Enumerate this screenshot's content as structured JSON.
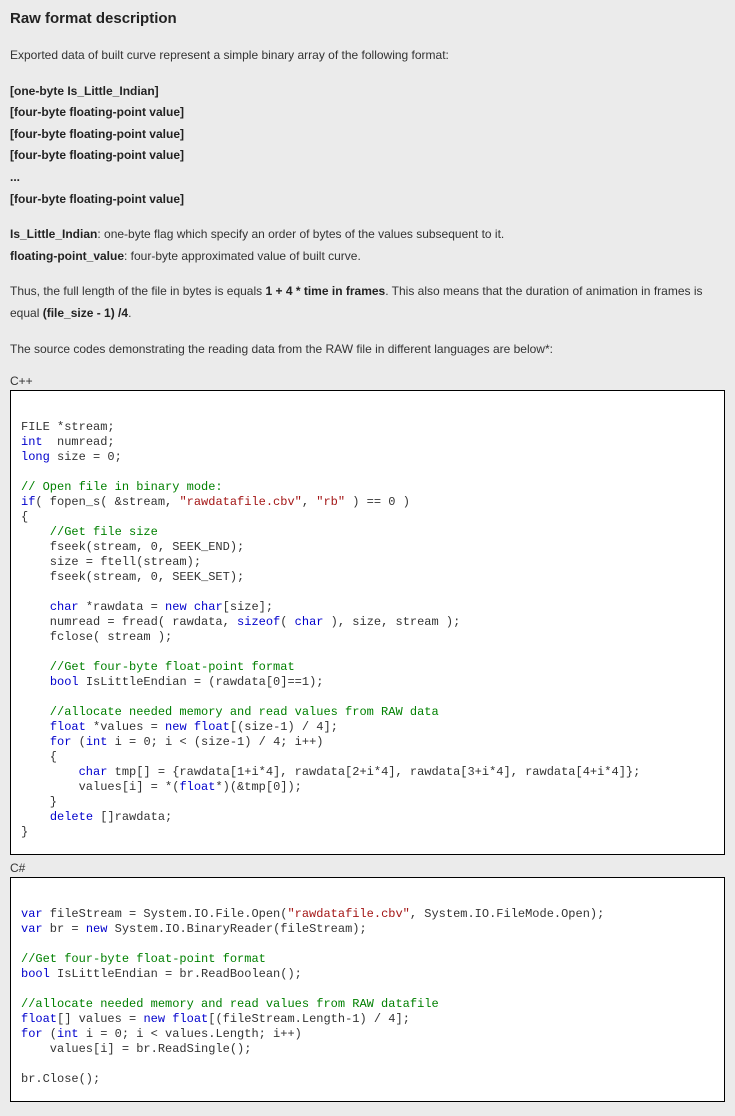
{
  "heading": "Raw format description",
  "intro": "Exported data of built curve represent a simple binary array of the following format:",
  "format_lines": [
    "[one-byte Is_Little_Indian]",
    "[four-byte floating-point value]",
    "[four-byte floating-point value]",
    "[four-byte floating-point value]",
    "...",
    "[four-byte floating-point value]"
  ],
  "definitions": [
    {
      "term": "Is_Little_Indian",
      "desc": ": one-byte flag which specify an order of bytes of the values subsequent to it."
    },
    {
      "term": "floating-point_value",
      "desc": ": four-byte approximated value of built curve."
    }
  ],
  "length_sentence": {
    "pre": "Thus, the full length of the file in bytes is equals ",
    "bold1": "1 + 4 * time in frames",
    "mid": ". This also means that the duration of animation in frames is equal ",
    "bold2": "(file_size - 1) /4",
    "post": "."
  },
  "source_intro": "The source codes demonstrating the reading data from the RAW file in different languages are below*:",
  "code_blocks": [
    {
      "label": "C++",
      "tokens": [
        {
          "t": "\n",
          "c": ""
        },
        {
          "t": "FILE",
          "c": ""
        },
        {
          "t": " *stream;\n",
          "c": ""
        },
        {
          "t": "int",
          "c": "kw"
        },
        {
          "t": "  numread;\n",
          "c": ""
        },
        {
          "t": "long",
          "c": "kw"
        },
        {
          "t": " size = 0;\n\n",
          "c": ""
        },
        {
          "t": "// Open file in binary mode:\n",
          "c": "cmt"
        },
        {
          "t": "if",
          "c": "kw"
        },
        {
          "t": "( fopen_s( &stream, ",
          "c": ""
        },
        {
          "t": "\"rawdatafile.cbv\"",
          "c": "str"
        },
        {
          "t": ", ",
          "c": ""
        },
        {
          "t": "\"rb\"",
          "c": "str"
        },
        {
          "t": " ) == 0 )\n{\n",
          "c": ""
        },
        {
          "t": "    //Get file size\n",
          "c": "cmt"
        },
        {
          "t": "    fseek(stream, 0, SEEK_END);\n",
          "c": ""
        },
        {
          "t": "    size = ftell(stream);\n",
          "c": ""
        },
        {
          "t": "    fseek(stream, 0, SEEK_SET);\n\n",
          "c": ""
        },
        {
          "t": "    ",
          "c": ""
        },
        {
          "t": "char",
          "c": "kw"
        },
        {
          "t": " *rawdata = ",
          "c": ""
        },
        {
          "t": "new",
          "c": "kw"
        },
        {
          "t": " ",
          "c": ""
        },
        {
          "t": "char",
          "c": "kw"
        },
        {
          "t": "[size];\n",
          "c": ""
        },
        {
          "t": "    numread = fread( rawdata, ",
          "c": ""
        },
        {
          "t": "sizeof",
          "c": "kw"
        },
        {
          "t": "( ",
          "c": ""
        },
        {
          "t": "char",
          "c": "kw"
        },
        {
          "t": " ), size, stream );\n",
          "c": ""
        },
        {
          "t": "    fclose( stream );\n\n",
          "c": ""
        },
        {
          "t": "    //Get four-byte float-point format\n",
          "c": "cmt"
        },
        {
          "t": "    ",
          "c": ""
        },
        {
          "t": "bool",
          "c": "kw"
        },
        {
          "t": " IsLittleEndian = (rawdata[0]==1);\n\n",
          "c": ""
        },
        {
          "t": "    //allocate needed memory and read values from RAW data\n",
          "c": "cmt"
        },
        {
          "t": "    ",
          "c": ""
        },
        {
          "t": "float",
          "c": "kw"
        },
        {
          "t": " *values = ",
          "c": ""
        },
        {
          "t": "new",
          "c": "kw"
        },
        {
          "t": " ",
          "c": ""
        },
        {
          "t": "float",
          "c": "kw"
        },
        {
          "t": "[(size-1) / 4];\n",
          "c": ""
        },
        {
          "t": "    ",
          "c": ""
        },
        {
          "t": "for",
          "c": "kw"
        },
        {
          "t": " (",
          "c": ""
        },
        {
          "t": "int",
          "c": "kw"
        },
        {
          "t": " i = 0; i < (size-1) / 4; i++)\n",
          "c": ""
        },
        {
          "t": "    {\n",
          "c": ""
        },
        {
          "t": "        ",
          "c": ""
        },
        {
          "t": "char",
          "c": "kw"
        },
        {
          "t": " tmp[] = {rawdata[1+i*4], rawdata[2+i*4], rawdata[3+i*4], rawdata[4+i*4]};\n",
          "c": ""
        },
        {
          "t": "        values[i] = *(",
          "c": ""
        },
        {
          "t": "float",
          "c": "kw"
        },
        {
          "t": "*)(&tmp[0]);\n",
          "c": ""
        },
        {
          "t": "    }\n",
          "c": ""
        },
        {
          "t": "    ",
          "c": ""
        },
        {
          "t": "delete",
          "c": "kw"
        },
        {
          "t": " []rawdata;\n",
          "c": ""
        },
        {
          "t": "}\n",
          "c": ""
        }
      ]
    },
    {
      "label": "C#",
      "tokens": [
        {
          "t": "\n",
          "c": ""
        },
        {
          "t": "var",
          "c": "kw"
        },
        {
          "t": " fileStream = System.IO.File.Open(",
          "c": ""
        },
        {
          "t": "\"rawdatafile.cbv\"",
          "c": "str"
        },
        {
          "t": ", System.IO.FileMode.Open);\n",
          "c": ""
        },
        {
          "t": "var",
          "c": "kw"
        },
        {
          "t": " br = ",
          "c": ""
        },
        {
          "t": "new",
          "c": "kw"
        },
        {
          "t": " System.IO.BinaryReader(fileStream);\n\n",
          "c": ""
        },
        {
          "t": "//Get four-byte float-point format\n",
          "c": "cmt"
        },
        {
          "t": "bool",
          "c": "kw"
        },
        {
          "t": " IsLittleEndian = br.ReadBoolean();\n\n",
          "c": ""
        },
        {
          "t": "//allocate needed memory and read values from RAW datafile\n",
          "c": "cmt"
        },
        {
          "t": "float",
          "c": "kw"
        },
        {
          "t": "[] values = ",
          "c": ""
        },
        {
          "t": "new",
          "c": "kw"
        },
        {
          "t": " ",
          "c": ""
        },
        {
          "t": "float",
          "c": "kw"
        },
        {
          "t": "[(fileStream.Length-1) / 4];\n",
          "c": ""
        },
        {
          "t": "for",
          "c": "kw"
        },
        {
          "t": " (",
          "c": ""
        },
        {
          "t": "int",
          "c": "kw"
        },
        {
          "t": " i = 0; i < values.Length; i++)\n",
          "c": ""
        },
        {
          "t": "    values[i] = br.ReadSingle();\n\n",
          "c": ""
        },
        {
          "t": "br.Close();\n",
          "c": ""
        }
      ]
    }
  ]
}
